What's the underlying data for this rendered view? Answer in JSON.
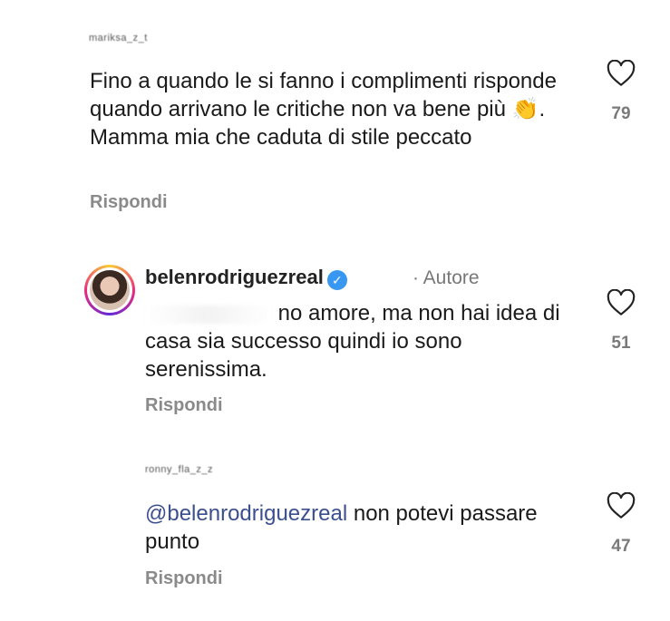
{
  "comments": [
    {
      "username": "mariksa_z_t",
      "text_part1": "Fino a quando le si fanno i complimenti risponde quando arrivano le critiche non va bene più ",
      "emoji": "👏",
      "text_part2": ". Mamma mia che caduta di stile peccato",
      "reply_label": "Rispondi",
      "likes": "79"
    },
    {
      "username": "belenrodriguezreal",
      "author_tag": "· Autore",
      "text": "no amore, ma non hai idea di casa sia successo quindi io sono serenissima.",
      "reply_label": "Rispondi",
      "likes": "51"
    },
    {
      "username": "ronny_fla_z_z",
      "mention": "@belenrodriguezreal",
      "text": " non potevi passare punto",
      "reply_label": "Rispondi",
      "likes": "47"
    }
  ],
  "colors": {
    "mention": "#3b4f8f",
    "verified": "#3897f0",
    "muted": "#8a8a8a"
  },
  "icons": {
    "like": "heart-outline-icon",
    "verified": "verified-badge-icon"
  }
}
